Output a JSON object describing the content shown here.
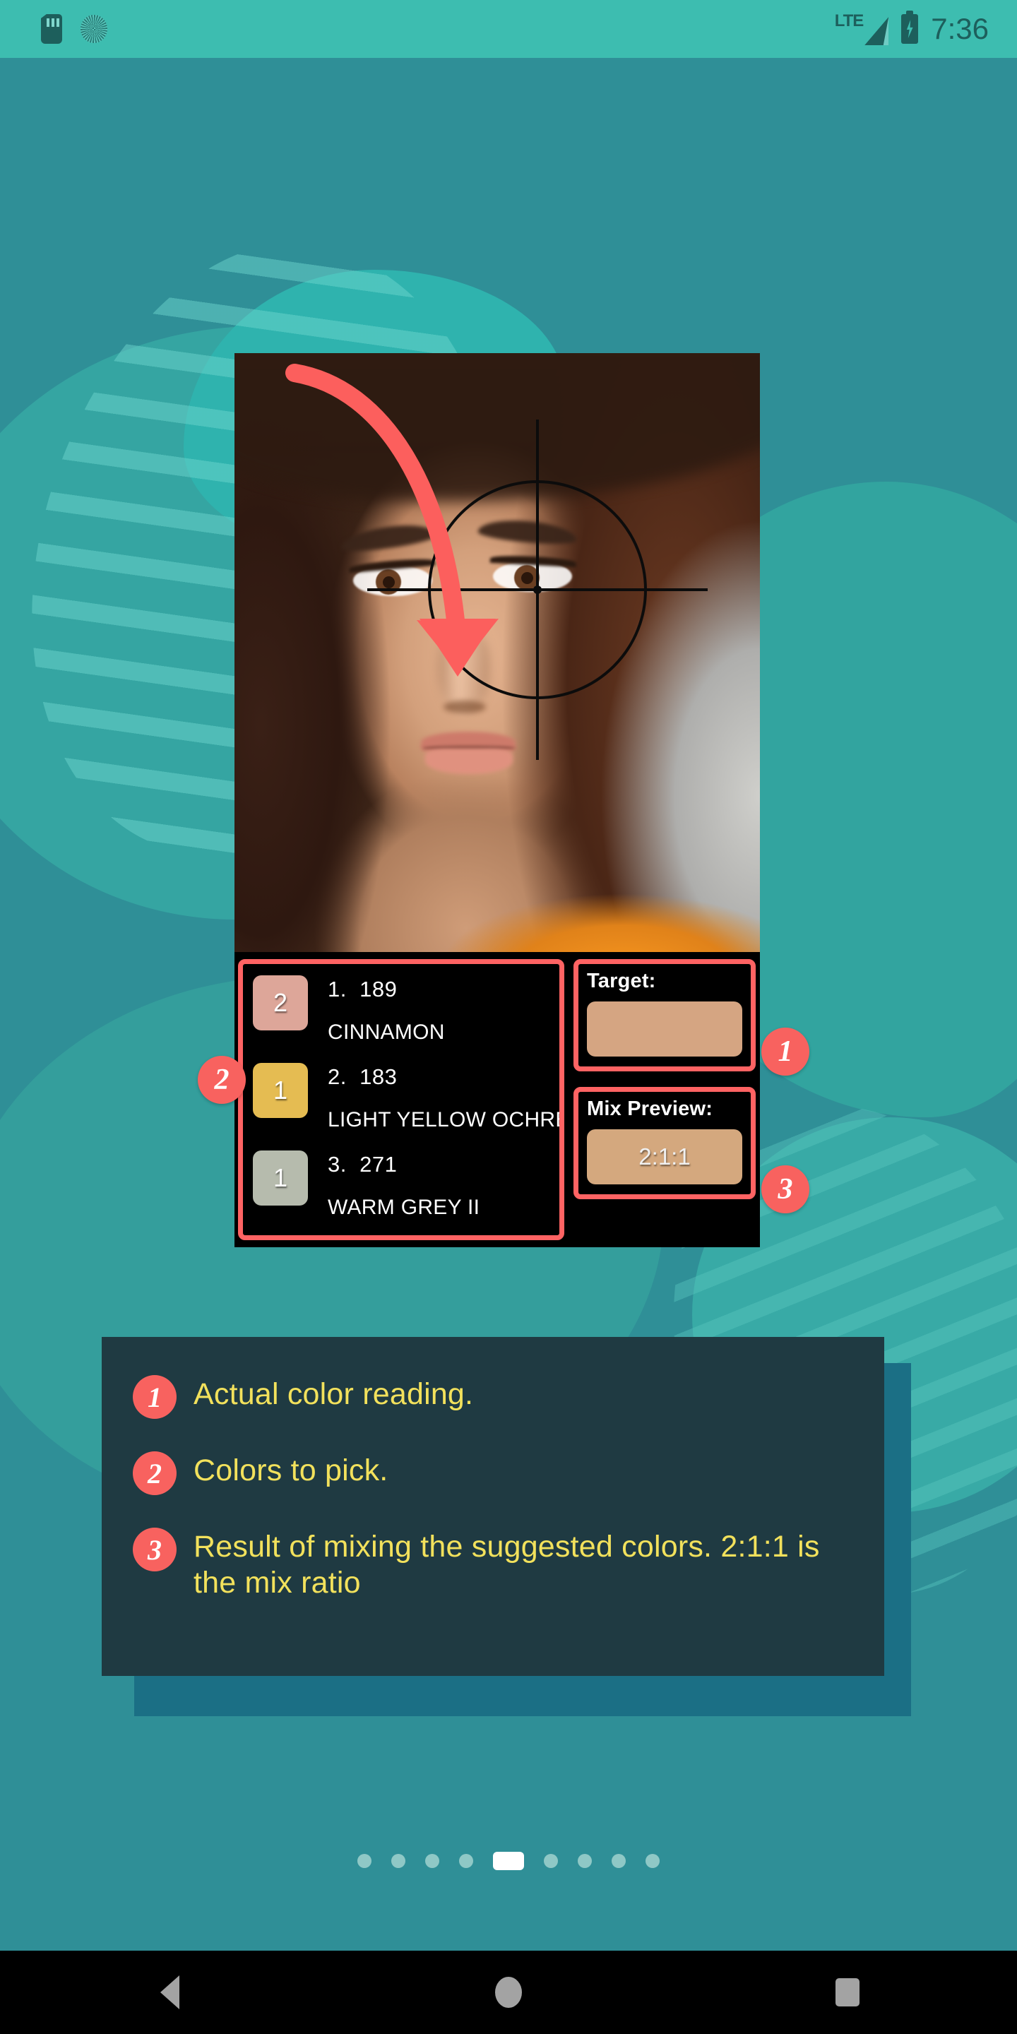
{
  "status_bar": {
    "icons_left": [
      "sd-card-icon",
      "sync-circle-icon"
    ],
    "network_label": "LTE",
    "icons_right": [
      "signal-icon",
      "battery-charging-icon"
    ],
    "time": "7:36"
  },
  "photo": {
    "alt": "portrait-of-woman-with-hat",
    "reticle": "crosshair-target-icon",
    "arrow": "curved-down-arrow"
  },
  "app_panel": {
    "colors": [
      {
        "index": "1.",
        "code": "189",
        "name": "CINNAMON",
        "parts": "2",
        "hex": "#dda699"
      },
      {
        "index": "2.",
        "code": "183",
        "name": "LIGHT YELLOW OCHRE",
        "parts": "1",
        "hex": "#e5bc52"
      },
      {
        "index": "3.",
        "code": "271",
        "name": "WARM GREY II",
        "parts": "1",
        "hex": "#b6bbad"
      }
    ],
    "target": {
      "label": "Target:",
      "hex": "#d5a582",
      "value": ""
    },
    "mix_preview": {
      "label": "Mix Preview:",
      "hex": "#d4a87e",
      "value": "2:1:1"
    }
  },
  "callouts": {
    "badge1": "1",
    "badge2": "2",
    "badge3": "3"
  },
  "legend": {
    "items": [
      {
        "badge": "1",
        "text": "Actual color reading."
      },
      {
        "badge": "2",
        "text": "Colors to pick."
      },
      {
        "badge": "3",
        "text": "Result of mixing the suggested colors. 2:1:1 is the mix ratio"
      }
    ]
  },
  "pager": {
    "total": 9,
    "active_index": 5
  },
  "nav_bar": {
    "back": "back-triangle-icon",
    "home": "home-circle-icon",
    "recents": "recents-square-icon"
  },
  "colors": {
    "accent_red": "#f8625f",
    "bg_teal": "#2f8f97",
    "status_teal": "#3dbdb0",
    "legend_bg": "#1f3a42",
    "legend_text": "#f2e15c"
  }
}
